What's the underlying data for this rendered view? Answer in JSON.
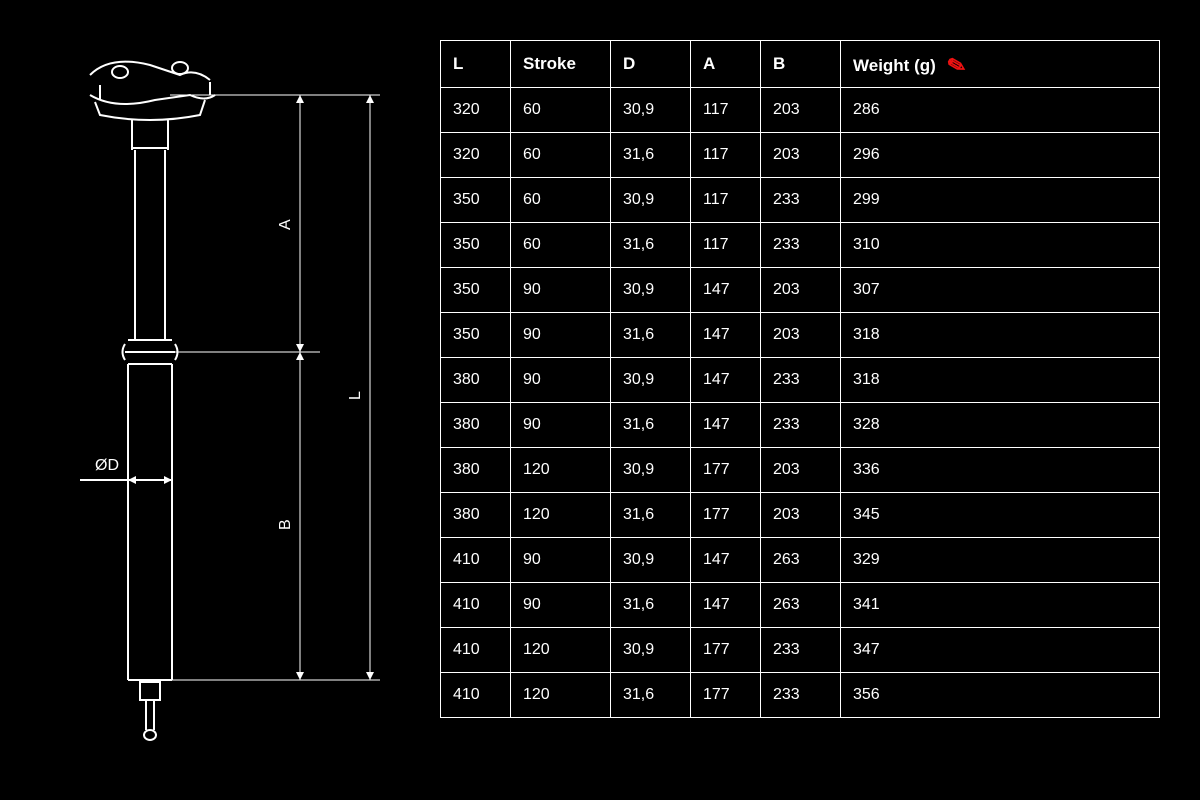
{
  "diagram": {
    "labels": {
      "diameter": "ØD",
      "length_total": "L",
      "length_upper": "A",
      "length_lower": "B"
    }
  },
  "table": {
    "headers": {
      "l": "L",
      "stroke": "Stroke",
      "d": "D",
      "a": "A",
      "b": "B",
      "weight": "Weight (g)"
    },
    "rows": [
      {
        "l": "320",
        "stroke": "60",
        "d": "30,9",
        "a": "117",
        "b": "203",
        "weight": "286"
      },
      {
        "l": "320",
        "stroke": "60",
        "d": "31,6",
        "a": "117",
        "b": "203",
        "weight": "296"
      },
      {
        "l": "350",
        "stroke": "60",
        "d": "30,9",
        "a": "117",
        "b": "233",
        "weight": "299"
      },
      {
        "l": "350",
        "stroke": "60",
        "d": "31,6",
        "a": "117",
        "b": "233",
        "weight": "310"
      },
      {
        "l": "350",
        "stroke": "90",
        "d": "30,9",
        "a": "147",
        "b": "203",
        "weight": "307"
      },
      {
        "l": "350",
        "stroke": "90",
        "d": "31,6",
        "a": "147",
        "b": "203",
        "weight": "318"
      },
      {
        "l": "380",
        "stroke": "90",
        "d": "30,9",
        "a": "147",
        "b": "233",
        "weight": "318"
      },
      {
        "l": "380",
        "stroke": "90",
        "d": "31,6",
        "a": "147",
        "b": "233",
        "weight": "328"
      },
      {
        "l": "380",
        "stroke": "120",
        "d": "30,9",
        "a": "177",
        "b": "203",
        "weight": "336"
      },
      {
        "l": "380",
        "stroke": "120",
        "d": "31,6",
        "a": "177",
        "b": "203",
        "weight": "345"
      },
      {
        "l": "410",
        "stroke": "90",
        "d": "30,9",
        "a": "147",
        "b": "263",
        "weight": "329"
      },
      {
        "l": "410",
        "stroke": "90",
        "d": "31,6",
        "a": "147",
        "b": "263",
        "weight": "341"
      },
      {
        "l": "410",
        "stroke": "120",
        "d": "30,9",
        "a": "177",
        "b": "233",
        "weight": "347"
      },
      {
        "l": "410",
        "stroke": "120",
        "d": "31,6",
        "a": "177",
        "b": "233",
        "weight": "356"
      }
    ]
  },
  "chart_data": {
    "type": "table",
    "title": "Seatpost dimensions and weight",
    "columns": [
      "L",
      "Stroke",
      "D",
      "A",
      "B",
      "Weight (g)"
    ],
    "rows": [
      [
        320,
        60,
        30.9,
        117,
        203,
        286
      ],
      [
        320,
        60,
        31.6,
        117,
        203,
        296
      ],
      [
        350,
        60,
        30.9,
        117,
        233,
        299
      ],
      [
        350,
        60,
        31.6,
        117,
        233,
        310
      ],
      [
        350,
        90,
        30.9,
        147,
        203,
        307
      ],
      [
        350,
        90,
        31.6,
        147,
        203,
        318
      ],
      [
        380,
        90,
        30.9,
        147,
        233,
        318
      ],
      [
        380,
        90,
        31.6,
        147,
        233,
        328
      ],
      [
        380,
        120,
        30.9,
        177,
        203,
        336
      ],
      [
        380,
        120,
        31.6,
        177,
        203,
        345
      ],
      [
        410,
        90,
        30.9,
        147,
        263,
        329
      ],
      [
        410,
        90,
        31.6,
        147,
        263,
        341
      ],
      [
        410,
        120,
        30.9,
        177,
        233,
        347
      ],
      [
        410,
        120,
        31.6,
        177,
        233,
        356
      ]
    ]
  }
}
